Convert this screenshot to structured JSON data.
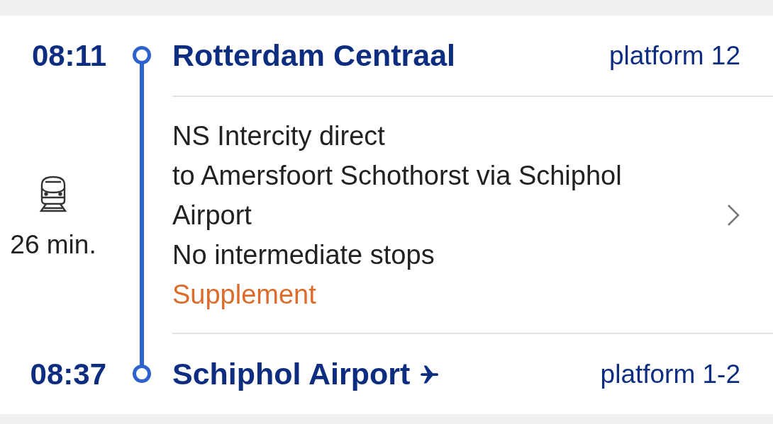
{
  "departure": {
    "time": "08:11",
    "station": "Rotterdam Centraal",
    "platform": "platform 12",
    "airport": false
  },
  "leg": {
    "duration": "26 min.",
    "lines": [
      {
        "kind": "plain",
        "text": "NS Intercity direct"
      },
      {
        "kind": "plain",
        "text": "to Amersfoort Schothorst via Schiphol Airport"
      },
      {
        "kind": "plain",
        "text": "No intermediate stops"
      },
      {
        "kind": "supplement",
        "text": "Supplement"
      }
    ]
  },
  "arrival": {
    "time": "08:37",
    "station": "Schiphol Airport",
    "platform": "platform 1-2",
    "airport": true
  }
}
